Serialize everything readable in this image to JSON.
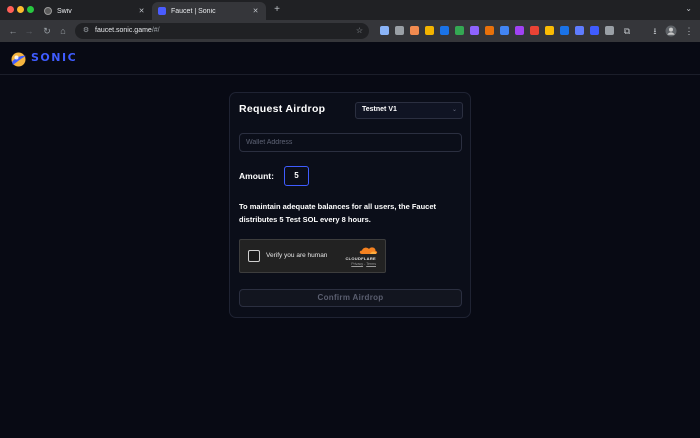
{
  "browser": {
    "tabs": [
      {
        "title": "Swiv",
        "active": false
      },
      {
        "title": "Faucet | Sonic",
        "active": true
      }
    ],
    "new_tab": "+",
    "tab_close": "✕",
    "url_host": "faucet.sonic.game",
    "url_path": "/#/",
    "extensions": [
      "#8ab4f8",
      "#9aa0a6",
      "#f28b50",
      "#f4b400",
      "#1a73e8",
      "#34a853",
      "#8e63ff",
      "#e8710a",
      "#4285f4",
      "#a142f4",
      "#ea4335",
      "#fbbc04",
      "#1a73e8",
      "#5f7cff",
      "#3f5cff",
      "#9aa0a6"
    ]
  },
  "site": {
    "logo_text": "SONIC",
    "accent_color": "#3f5cff"
  },
  "form": {
    "title": "Request Airdrop",
    "network_selected": "Testnet V1",
    "wallet_placeholder": "Wallet Address",
    "amount_label": "Amount:",
    "amount_value": "5",
    "notice": "To maintain adequate balances for all users, the Faucet distributes 5 Test SOL every 8 hours.",
    "captcha_label": "Verify you are human",
    "captcha_brand": "CLOUDFLARE",
    "captcha_privacy": "Privacy",
    "captcha_sep": "-",
    "captcha_terms": "Terms",
    "confirm_label": "Confirm Airdrop"
  }
}
